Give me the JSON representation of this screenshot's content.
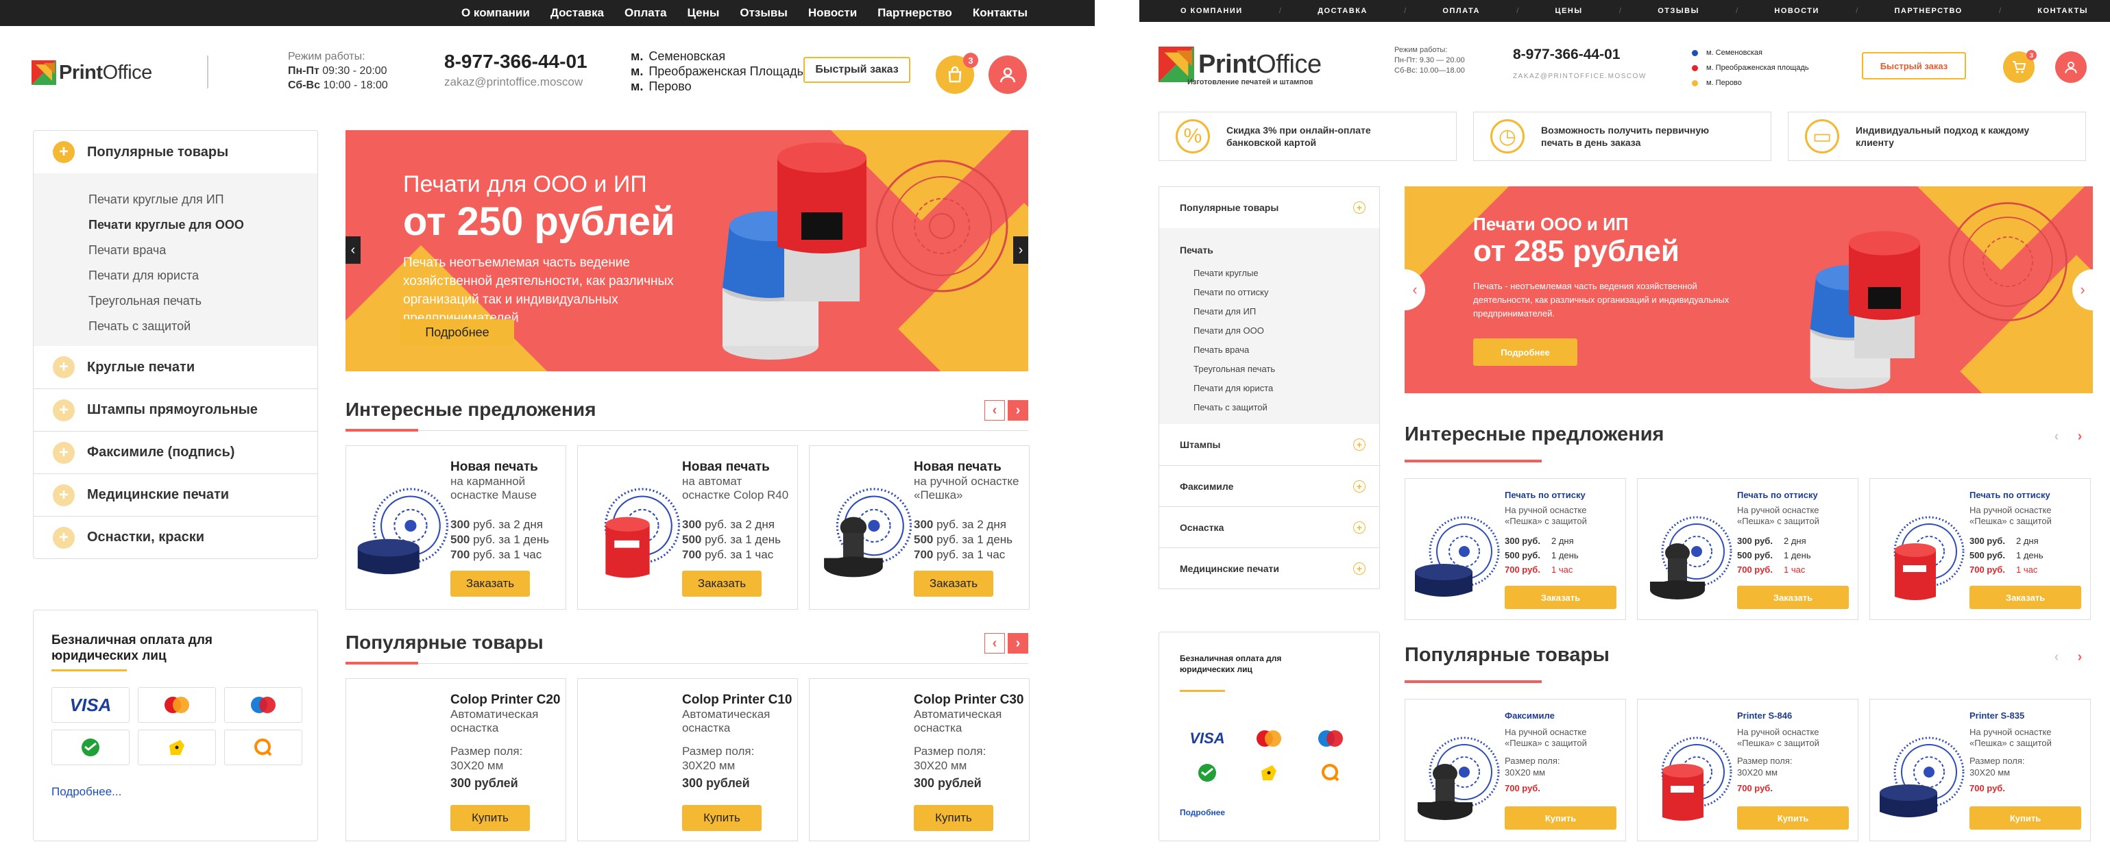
{
  "left": {
    "topnav": [
      "О компании",
      "Доставка",
      "Оплата",
      "Цены",
      "Отзывы",
      "Новости",
      "Партнерство",
      "Контакты"
    ],
    "logo": {
      "bold": "Print",
      "rest": "Office"
    },
    "hours": {
      "label": "Режим работы:",
      "weekdays_label": "Пн-Пт",
      "weekdays": "09:30 - 20:00",
      "weekend_label": "Сб-Вс",
      "weekend": "10:00 - 18:00"
    },
    "phone": "8-977-366-44-01",
    "email": "zakaz@printoffice.moscow",
    "metro": [
      {
        "m": "м.",
        "name": "Семеновская"
      },
      {
        "m": "м.",
        "name": "Преображенская Площадь"
      },
      {
        "m": "м.",
        "name": "Перово"
      }
    ],
    "quick_order": "Быстрый заказ",
    "cart_count": "3",
    "sidebar": {
      "popular": "Популярные товары",
      "subitems": [
        {
          "label": "Печати круглые для ИП",
          "bold": false
        },
        {
          "label": "Печати круглые для ООО",
          "bold": true
        },
        {
          "label": "Печати врача",
          "bold": false
        },
        {
          "label": "Печати для юриста",
          "bold": false
        },
        {
          "label": "Треугольная печать",
          "bold": false
        },
        {
          "label": "Печать с защитой",
          "bold": false
        }
      ],
      "categories": [
        "Круглые печати",
        "Штампы прямоугольные",
        "Факсимиле (подпись)",
        "Медицинские печати",
        "Оснастки, краски"
      ]
    },
    "payment": {
      "title": "Безналичная оплата для юридических лиц",
      "cards": [
        "VISA",
        "mastercard",
        "Maestro",
        "sber",
        "yandex",
        "qiwi"
      ],
      "more": "Подробнее..."
    },
    "banner": {
      "line1": "Печати для ООО и ИП",
      "line2_pre": "от",
      "line2_price": "250 рублей",
      "text": "Печать неотъемлемая часть ведение хозяйственной деятельности, как различных организаций так и индивидуальных предпринимателей",
      "button": "Подробнее"
    },
    "offers_title": "Интересные предложения",
    "offers": [
      {
        "title": "Новая печать",
        "desc": "на карманной оснастке Mause",
        "prices": [
          {
            "p": "300",
            "t": "руб. за 2 дня"
          },
          {
            "p": "500",
            "t": "руб. за 1 день"
          },
          {
            "p": "700",
            "t": "руб. за 1 час"
          }
        ],
        "button": "Заказать",
        "type": "pocket"
      },
      {
        "title": "Новая печать",
        "desc": "на автомат оснастке Colop R40",
        "prices": [
          {
            "p": "300",
            "t": "руб. за 2 дня"
          },
          {
            "p": "500",
            "t": "руб. за 1 день"
          },
          {
            "p": "700",
            "t": "руб. за 1 час"
          }
        ],
        "button": "Заказать",
        "type": "red"
      },
      {
        "title": "Новая печать",
        "desc": "на ручной оснастке «Пешка»",
        "prices": [
          {
            "p": "300",
            "t": "руб. за 2 дня"
          },
          {
            "p": "500",
            "t": "руб. за 1 день"
          },
          {
            "p": "700",
            "t": "руб. за 1 час"
          }
        ],
        "button": "Заказать",
        "type": "black"
      }
    ],
    "popular_title": "Популярные товары",
    "popular": [
      {
        "title": "Colop Printer C20",
        "desc": "Автоматическая оснастка",
        "field_label": "Размер поля:",
        "field": "30Х20 мм",
        "price": "300 рублей",
        "button": "Купить"
      },
      {
        "title": "Colop Printer C10",
        "desc": "Автоматическая оснастка",
        "field_label": "Размер поля:",
        "field": "30Х20 мм",
        "price": "300 рублей",
        "button": "Купить"
      },
      {
        "title": "Colop Printer C30",
        "desc": "Автоматическая оснастка",
        "field_label": "Размер поля:",
        "field": "30Х20 мм",
        "price": "300 рублей",
        "button": "Купить"
      }
    ]
  },
  "right": {
    "topnav": [
      "О КОМПАНИИ",
      "ДОСТАВКА",
      "ОПЛАТА",
      "ЦЕНЫ",
      "ОТЗЫВЫ",
      "НОВОСТИ",
      "ПАРТНЕРСТВО",
      "КОНТАКТЫ"
    ],
    "logo": {
      "bold": "Print",
      "rest": "Office",
      "tagline": "Изготовление печатей и штампов"
    },
    "hours": {
      "label": "Режим работы:",
      "weekdays": "Пн-Пт: 9.30 — 20.00",
      "weekend": "Сб-Вс: 10.00—18.00"
    },
    "phone": "8-977-366-44-01",
    "email": "ZAKAZ@PRINTOFFICE.MOSCOW",
    "metro": [
      {
        "name": "м. Семеновская",
        "color": "#1e4fb8"
      },
      {
        "name": "м. Преображенская площадь",
        "color": "#e0262b"
      },
      {
        "name": "м. Перово",
        "color": "#f5b833"
      }
    ],
    "quick_order": "Быстрый заказ",
    "cart_count": "3",
    "features": [
      {
        "icon": "percent-icon",
        "text": "Скидка 3% при онлайн-оплате банковской картой"
      },
      {
        "icon": "clock-icon",
        "text": "Возможность получить первичную печать в день заказа"
      },
      {
        "icon": "briefcase-icon",
        "text": "Индивидуальный подход к каждому клиенту"
      }
    ],
    "sidebar": {
      "popular": "Популярные товары",
      "section": "Печать",
      "subitems": [
        "Печати круглые",
        "Печати по оттиску",
        "Печати для ИП",
        "Печати для ООО",
        "Печать врача",
        "Треугольная печать",
        "Печати для юриста",
        "Печать с защитой"
      ],
      "categories": [
        "Штампы",
        "Факсимиле",
        "Оснастка",
        "Медицинские печати"
      ]
    },
    "payment": {
      "title": "Безналичная оплата для юридических лиц",
      "more": "Подробнее"
    },
    "banner": {
      "line1": "Печати ООО и ИП",
      "line2": "от 285 рублей",
      "text": "Печать - неотъемлемая часть ведения хозяйственной деятельности, как различных организаций и индивидуальных предпринимателей.",
      "button": "Подробнее"
    },
    "offers_title": "Интересные предложения",
    "offers": [
      {
        "title": "Печать по оттиску",
        "desc": "На ручной оснастке «Пешка» с защитой",
        "prices": [
          {
            "p": "300 руб.",
            "t": "2 дня"
          },
          {
            "p": "500 руб.",
            "t": "1 день"
          },
          {
            "p": "700 руб.",
            "t": "1 час"
          }
        ],
        "button": "Заказать",
        "type": "pocket"
      },
      {
        "title": "Печать по оттиску",
        "desc": "На ручной оснастке «Пешка» с защитой",
        "prices": [
          {
            "p": "300 руб.",
            "t": "2 дня"
          },
          {
            "p": "500 руб.",
            "t": "1 день"
          },
          {
            "p": "700 руб.",
            "t": "1 час"
          }
        ],
        "button": "Заказать",
        "type": "black"
      },
      {
        "title": "Печать по оттиску",
        "desc": "На ручной оснастке «Пешка» с защитой",
        "prices": [
          {
            "p": "300 руб.",
            "t": "2 дня"
          },
          {
            "p": "500 руб.",
            "t": "1 день"
          },
          {
            "p": "700 руб.",
            "t": "1 час"
          }
        ],
        "button": "Заказать",
        "type": "red"
      }
    ],
    "popular_title": "Популярные товары",
    "popular": [
      {
        "title": "Факсимиле",
        "desc": "На ручной оснастке «Пешка» с защитой",
        "field_label": "Размер поля:",
        "field": "30Х20 мм",
        "price": "700 руб.",
        "button": "Купить",
        "type": "black"
      },
      {
        "title": "Printer S-846",
        "desc": "На ручной оснастке «Пешка» с защитой",
        "field_label": "Размер поля:",
        "field": "30Х20 мм",
        "price": "700 руб.",
        "button": "Купить",
        "type": "red"
      },
      {
        "title": "Printer S-835",
        "desc": "На ручной оснастке «Пешка» с защитой",
        "field_label": "Размер поля:",
        "field": "30Х20 мм",
        "price": "700 руб.",
        "button": "Купить",
        "type": "pocket"
      }
    ]
  }
}
